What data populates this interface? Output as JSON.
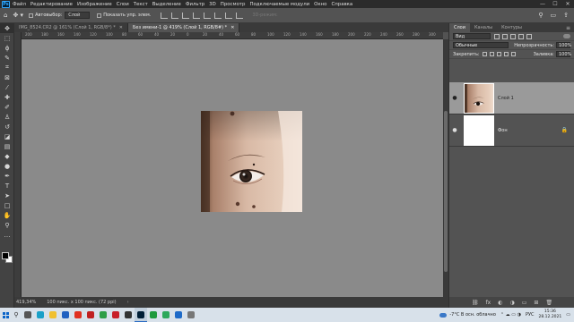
{
  "menubar": {
    "logo": "Ps",
    "items": [
      "Файл",
      "Редактирование",
      "Изображение",
      "Слои",
      "Текст",
      "Выделение",
      "Фильтр",
      "3D",
      "Просмотр",
      "Подключаемые модули",
      "Окно",
      "Справка"
    ],
    "window_controls": [
      "—",
      "☐",
      "✕"
    ]
  },
  "options": {
    "autoselect_label": "Автовыбор:",
    "autoselect_value": "Слой",
    "show_controls_label": "Показать упр. элем.",
    "mode_3d_label": "3D-режим:"
  },
  "tools": [
    {
      "name": "move-tool",
      "glyph": "✥"
    },
    {
      "name": "artboard-tool",
      "glyph": "⬚"
    },
    {
      "name": "lasso-tool",
      "glyph": "ϕ"
    },
    {
      "name": "quick-select-tool",
      "glyph": "✎"
    },
    {
      "name": "crop-tool",
      "glyph": "⌗"
    },
    {
      "name": "frame-tool",
      "glyph": "⊠"
    },
    {
      "name": "eyedropper-tool",
      "glyph": "⁄"
    },
    {
      "name": "healing-tool",
      "glyph": "✚"
    },
    {
      "name": "brush-tool",
      "glyph": "✐"
    },
    {
      "name": "stamp-tool",
      "glyph": "♙"
    },
    {
      "name": "history-brush-tool",
      "glyph": "↺"
    },
    {
      "name": "eraser-tool",
      "glyph": "◪"
    },
    {
      "name": "gradient-tool",
      "glyph": "▤"
    },
    {
      "name": "blur-tool",
      "glyph": "◆"
    },
    {
      "name": "dodge-tool",
      "glyph": "●"
    },
    {
      "name": "pen-tool",
      "glyph": "✒"
    },
    {
      "name": "type-tool",
      "glyph": "T"
    },
    {
      "name": "path-select-tool",
      "glyph": "➤"
    },
    {
      "name": "shape-tool",
      "glyph": "□"
    },
    {
      "name": "hand-tool",
      "glyph": "✋"
    },
    {
      "name": "zoom-tool",
      "glyph": "⚲"
    },
    {
      "name": "more-tools",
      "glyph": "…"
    }
  ],
  "tabs": [
    {
      "label": "IMG_8524.CR2 @ 161% (Слой 1, RGB/8*) *",
      "close": "✕"
    },
    {
      "label": "Без имени-1 @ 419% (Слой 1, RGB/8#) *",
      "close": "✕"
    }
  ],
  "ruler_labels": [
    "200",
    "180",
    "160",
    "140",
    "120",
    "100",
    "80",
    "60",
    "40",
    "20",
    "0",
    "20",
    "40",
    "60",
    "80",
    "100",
    "120",
    "140",
    "160",
    "180",
    "200",
    "220",
    "240",
    "260",
    "280",
    "300"
  ],
  "status": {
    "zoom": "419,34%",
    "doc_info": "100 пикс. x 100 пикс. (72 ppi)",
    "arrow": "›"
  },
  "layers_panel": {
    "tabs": [
      "Слои",
      "Каналы",
      "Контуры"
    ],
    "menu": "≡",
    "filter_value": "Вид",
    "blend_mode": "Обычные",
    "opacity_label": "Непрозрачность:",
    "opacity_value": "100%",
    "lock_label": "Закрепить:",
    "fill_label": "Заливка:",
    "fill_value": "100%",
    "layers": [
      {
        "name": "Слой 1",
        "selected": true
      },
      {
        "name": "Фон",
        "selected": false
      }
    ],
    "footer_icons": [
      "⛓",
      "fx",
      "◐",
      "◑",
      "▭",
      "⊞",
      "🗑"
    ]
  },
  "taskbar": {
    "weather": "-7°С В осн. облачно",
    "language": "РУС",
    "time": "15:36",
    "date": "28.12.2021",
    "tray_icons": "⌃ ☁ ▭ ◑",
    "apps": [
      {
        "name": "task-view",
        "color": "#555555"
      },
      {
        "name": "edge",
        "color": "#1aa0c8"
      },
      {
        "name": "explorer",
        "color": "#f0c030"
      },
      {
        "name": "store",
        "color": "#2060c0"
      },
      {
        "name": "yandex",
        "color": "#e03020"
      },
      {
        "name": "youtube",
        "color": "#c02020"
      },
      {
        "name": "chrome",
        "color": "#2e9e46"
      },
      {
        "name": "opera",
        "color": "#c81e28"
      },
      {
        "name": "app-dark",
        "color": "#333333"
      },
      {
        "name": "photoshop",
        "color": "#001e36"
      },
      {
        "name": "camtasia",
        "color": "#1f9a3c"
      },
      {
        "name": "app-green",
        "color": "#2ca85a"
      },
      {
        "name": "app-blue",
        "color": "#1e6ac8"
      },
      {
        "name": "app-gray",
        "color": "#777777"
      }
    ]
  }
}
